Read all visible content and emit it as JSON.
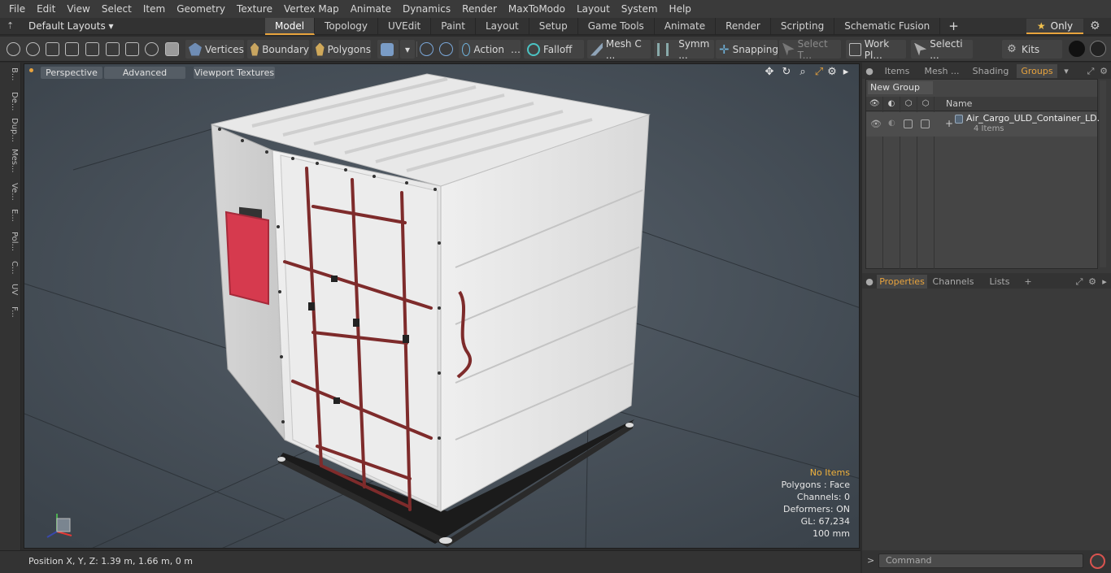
{
  "menu": [
    "File",
    "Edit",
    "View",
    "Select",
    "Item",
    "Geometry",
    "Texture",
    "Vertex Map",
    "Animate",
    "Dynamics",
    "Render",
    "MaxToModo",
    "Layout",
    "System",
    "Help"
  ],
  "layout_select": "Default Layouts ▾",
  "tabs": [
    "Model",
    "Topology",
    "UVEdit",
    "Paint",
    "Layout",
    "Setup",
    "Game Tools",
    "Animate",
    "Render",
    "Scripting",
    "Schematic Fusion"
  ],
  "active_tab": "Model",
  "only_label": "Only",
  "toolbar": {
    "vertices": "Vertices",
    "boundary": "Boundary",
    "polygons": "Polygons",
    "action": "Action",
    "falloff": "Falloff",
    "mesh": "Mesh C ...",
    "symm": "Symm ...",
    "snapping": "Snapping",
    "select_t": "Select T...",
    "work_pl": "Work Pl...",
    "selecti": "Selecti ...",
    "kits": "Kits"
  },
  "left_tabs": [
    "B...",
    "De...",
    "Dup...",
    "Mes...",
    "Ve...",
    "E...",
    "Pol...",
    "C...",
    "UV",
    "F..."
  ],
  "viewport": {
    "perspective": "Perspective",
    "advanced": "Advanced",
    "viewport_textures": "Viewport Textures"
  },
  "stats": {
    "no_items": "No Items",
    "polygons": "Polygons : Face",
    "channels": "Channels: 0",
    "deformers": "Deformers: ON",
    "gl": "GL: 67,234",
    "scale": "100 mm"
  },
  "status": {
    "position": "Position X, Y, Z:   1.39 m, 1.66 m, 0 m"
  },
  "right_tabs": [
    "Items",
    "Mesh ...",
    "Shading",
    "Groups"
  ],
  "active_right_tab": "Groups",
  "groups": {
    "new_group": "New Group",
    "name_header": "Name",
    "row_name": "Air_Cargo_ULD_Container_LD...",
    "row_count": "4 Items"
  },
  "prop_tabs": [
    "Properties",
    "Channels",
    "Lists"
  ],
  "command_placeholder": "Command",
  "colors": {
    "accent": "#e8a33d",
    "viewport_bg": "#475058",
    "container": "#e9e9e9",
    "strap": "#8a2f2f",
    "red_panel": "#d63a4e"
  }
}
